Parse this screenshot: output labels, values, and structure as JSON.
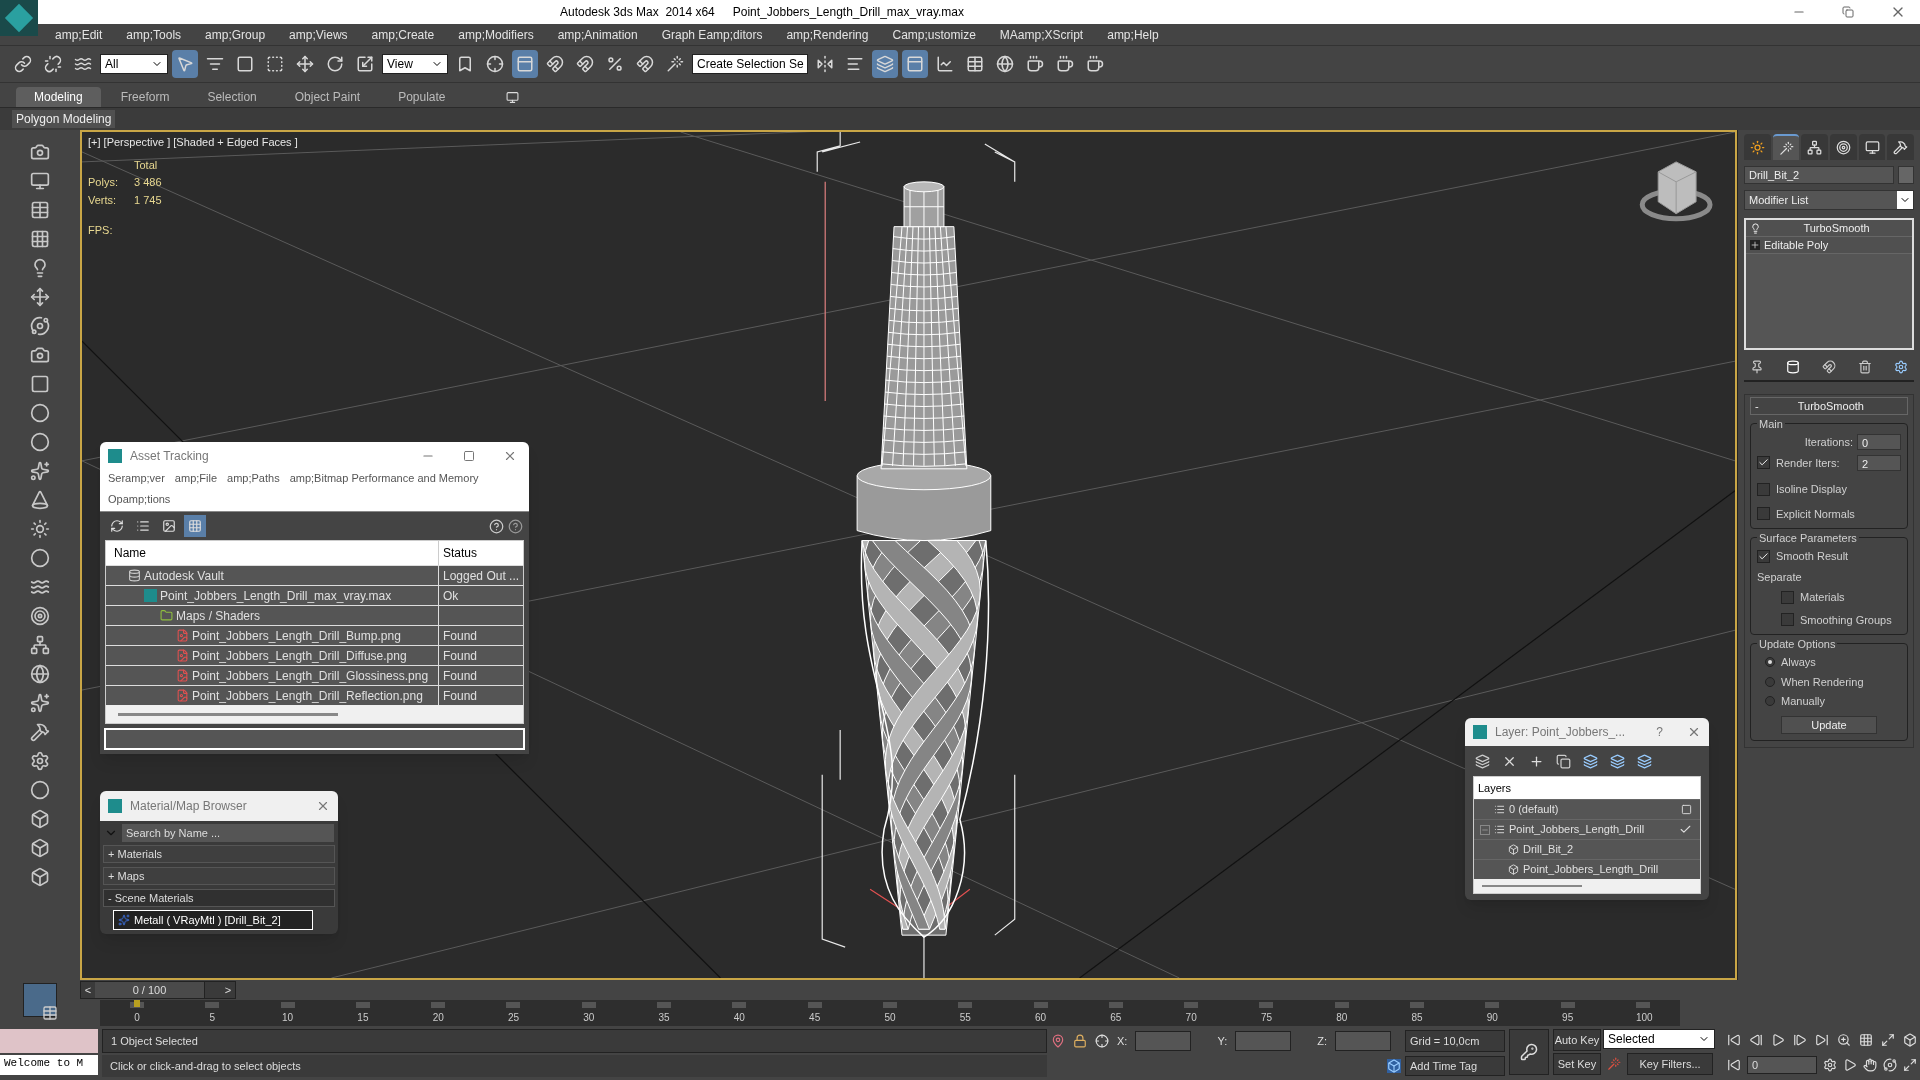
{
  "window": {
    "title": "Autodesk 3ds Max  2014 x64",
    "file": "Point_Jobbers_Length_Drill_max_vray.max"
  },
  "menu": [
    "amp;Edit",
    "amp;Tools",
    "amp;Group",
    "amp;Views",
    "amp;Create",
    "amp;Modifiers",
    "amp;Animation",
    "Graph Eamp;ditors",
    "amp;Rendering",
    "Camp;ustomize",
    "MAamp;XScript",
    "amp;Help"
  ],
  "toolbar": {
    "selection_filter": "All",
    "reference_coord": "View",
    "named_selection": "Create Selection Se"
  },
  "ribbon": {
    "tabs": [
      {
        "label": "Modeling",
        "selected": true
      },
      {
        "label": "Freeform",
        "selected": false
      },
      {
        "label": "Selection",
        "selected": false
      },
      {
        "label": "Object Paint",
        "selected": false
      },
      {
        "label": "Populate",
        "selected": false
      }
    ],
    "panel": "Polygon Modeling"
  },
  "viewport": {
    "label": "[+] [Perspective ] [Shaded + Edged Faces ]",
    "stats_header": "Total",
    "stats": [
      {
        "label": "Polys:",
        "value": "3 486"
      },
      {
        "label": "Verts:",
        "value": "1 745"
      }
    ],
    "fps": "FPS:"
  },
  "asset_tracking": {
    "title": "Asset Tracking",
    "menu": [
      "Seramp;ver",
      "amp;File",
      "amp;Paths",
      "amp;Bitmap Performance and Memory",
      "Opamp;tions"
    ],
    "views": [
      {
        "selected": false
      },
      {
        "selected": false
      },
      {
        "selected": false
      },
      {
        "selected": true
      }
    ],
    "columns": [
      "Name",
      "Status"
    ],
    "rows": [
      {
        "kind": "vault",
        "name": "Autodesk Vault",
        "status": "Logged Out ...",
        "children": [
          {
            "kind": "scene",
            "name": "Point_Jobbers_Length_Drill_max_vray.max",
            "status": "Ok",
            "children": [
              {
                "kind": "folder",
                "name": "Maps / Shaders",
                "children": [
                  {
                    "kind": "png",
                    "name": "Point_Jobbers_Length_Drill_Bump.png",
                    "status": "Found"
                  },
                  {
                    "kind": "png",
                    "name": "Point_Jobbers_Length_Drill_Diffuse.png",
                    "status": "Found"
                  },
                  {
                    "kind": "png",
                    "name": "Point_Jobbers_Length_Drill_Glossiness.png",
                    "status": "Found"
                  },
                  {
                    "kind": "png",
                    "name": "Point_Jobbers_Length_Drill_Reflection.png",
                    "status": "Found"
                  }
                ]
              }
            ]
          }
        ]
      }
    ]
  },
  "material_browser": {
    "title": "Material/Map Browser",
    "placeholder": "Search by Name ...",
    "groups": [
      {
        "label": "+ Materials",
        "expanded": false
      },
      {
        "label": "+ Maps",
        "expanded": false
      },
      {
        "label": "- Scene Materials",
        "expanded": true,
        "items": [
          {
            "label": "Metall  ( VRayMtl ) [Drill_Bit_2]",
            "selected": true
          }
        ]
      }
    ]
  },
  "layer_manager": {
    "title": "Layer: Point_Jobbers_...",
    "help": "?",
    "header": "Layers",
    "layers": [
      {
        "kind": "layer",
        "name": "0 (default)",
        "current": false
      },
      {
        "kind": "layer",
        "name": "Point_Jobbers_Length_Drill",
        "current": true,
        "expanded": true,
        "children": [
          {
            "kind": "object",
            "name": "Drill_Bit_2"
          },
          {
            "kind": "object",
            "name": "Point_Jobbers_Length_Drill"
          }
        ]
      }
    ]
  },
  "command_panel": {
    "tabs": [
      {
        "selected": false
      },
      {
        "selected": true
      },
      {
        "selected": false
      },
      {
        "selected": false
      },
      {
        "selected": false
      },
      {
        "selected": false
      }
    ],
    "object_name": "Drill_Bit_2",
    "modifier_list": "Modifier List",
    "stack": [
      {
        "kind": "modifier",
        "label": "TurboSmooth"
      },
      {
        "kind": "base",
        "label": "Editable Poly"
      }
    ],
    "rollout": {
      "sign": "-",
      "title": "TurboSmooth",
      "main": {
        "title": "Main",
        "iterations_label": "Iterations:",
        "iterations": "0",
        "render_iters": {
          "label": "Render Iters:",
          "checked": true,
          "value": "2"
        },
        "options": [
          {
            "label": "Isoline Display",
            "checked": false
          },
          {
            "label": "Explicit Normals",
            "checked": false
          }
        ]
      },
      "surface": {
        "title": "Surface Parameters",
        "smooth_result": {
          "label": "Smooth Result",
          "checked": true
        },
        "separate_label": "Separate",
        "separate": [
          {
            "label": "Materials",
            "checked": false
          },
          {
            "label": "Smoothing Groups",
            "checked": false
          }
        ]
      },
      "update": {
        "title": "Update Options",
        "options": [
          {
            "label": "Always",
            "selected": true
          },
          {
            "label": "When Rendering",
            "selected": false
          },
          {
            "label": "Manually",
            "selected": false
          }
        ],
        "button": "Update"
      }
    }
  },
  "timeline": {
    "frame": "0 / 100",
    "level": 0,
    "prev": "<",
    "next": ">",
    "ticks": [
      "0",
      "5",
      "10",
      "15",
      "20",
      "25",
      "30",
      "35",
      "40",
      "45",
      "50",
      "55",
      "60",
      "65",
      "70",
      "75",
      "80",
      "85",
      "90",
      "95",
      "100"
    ]
  },
  "status": {
    "welcome": "Welcome to M",
    "selection": "1 Object Selected",
    "prompt": "Click or click-and-drag to select objects",
    "x_label": "X:",
    "y_label": "Y:",
    "z_label": "Z:",
    "grid": "Grid = 10,0cm",
    "time_tag": "Add Time Tag",
    "auto_key": "Auto Key",
    "set_key": "Set Key",
    "key_mode": "Selected",
    "key_filters": "Key Filters...",
    "current_frame": "0"
  }
}
